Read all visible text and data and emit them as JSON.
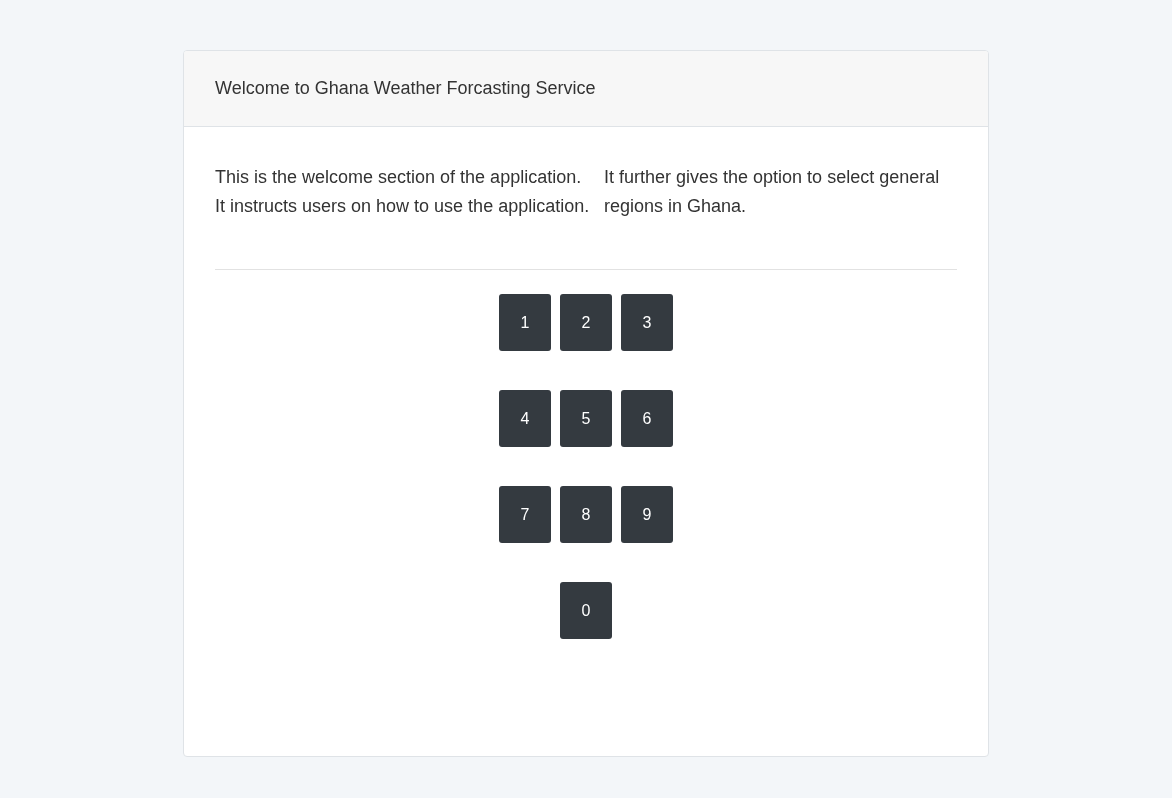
{
  "card": {
    "title": "Welcome to Ghana Weather Forcasting Service",
    "paragraphs": [
      "This is the welcome section of the application. It instructs users on how to use the application.",
      "It further gives the option to select general regions in Ghana."
    ],
    "keypad": [
      [
        "1",
        "2",
        "3"
      ],
      [
        "4",
        "5",
        "6"
      ],
      [
        "7",
        "8",
        "9"
      ],
      [
        "0"
      ]
    ]
  }
}
